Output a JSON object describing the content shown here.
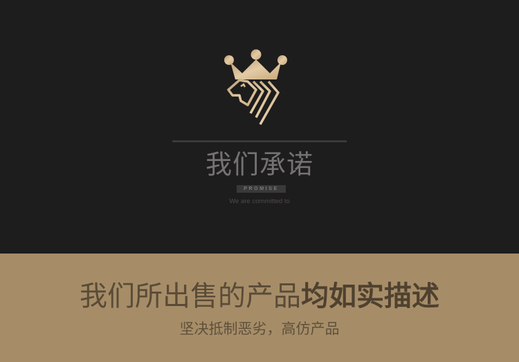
{
  "brand": {
    "logo_icon": "crown-lion-icon",
    "title": "我们承诺",
    "badge": "PROMISE",
    "subtitle": "We are committed to"
  },
  "promise": {
    "headline_regular": "我们所出售的产品",
    "headline_bold": "均如实描述",
    "tagline": "坚决抵制恶劣，高仿产品"
  },
  "colors": {
    "dark_background": "#1e1d1d",
    "tan_background": "#a68d68",
    "gold_accent": "#d9be93"
  }
}
